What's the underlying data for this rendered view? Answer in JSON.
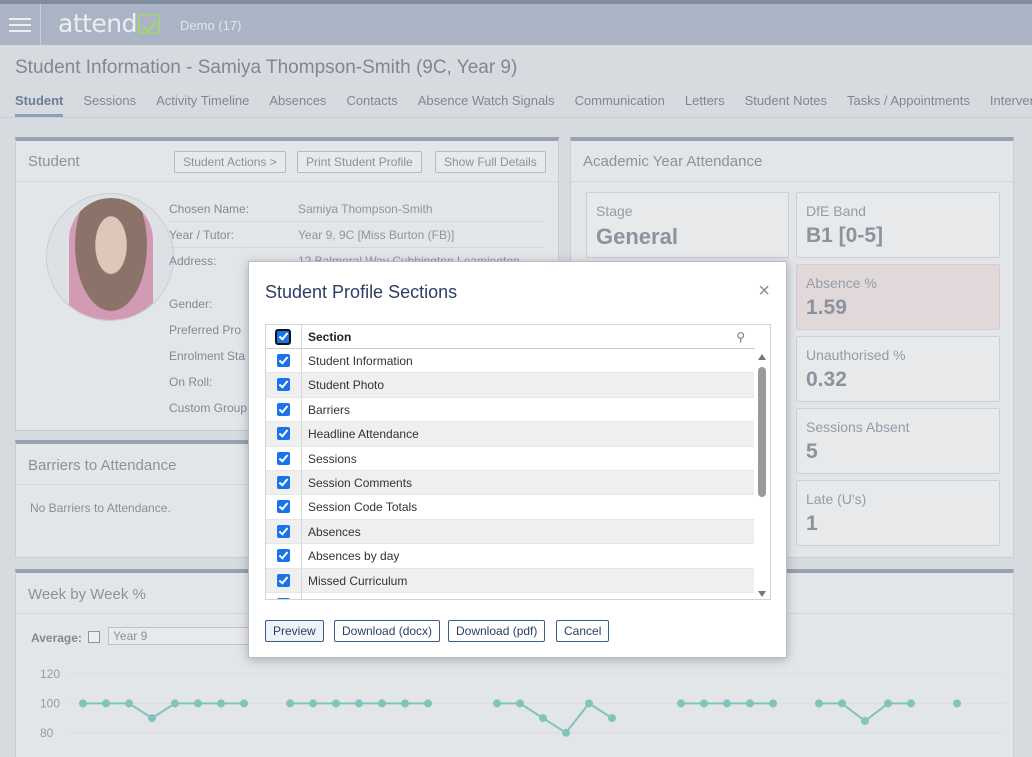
{
  "header": {
    "app_name": "attend",
    "org": "Demo (17)"
  },
  "page": {
    "title": "Student Information - Samiya Thompson-Smith (9C, Year 9)"
  },
  "tabs": [
    "Student",
    "Sessions",
    "Activity Timeline",
    "Absences",
    "Contacts",
    "Absence Watch Signals",
    "Communication",
    "Letters",
    "Student Notes",
    "Tasks / Appointments",
    "Interven"
  ],
  "student_panel": {
    "title": "Student",
    "actions": [
      "Student Actions >",
      "Print Student Profile",
      "Show Full Details"
    ],
    "fields": [
      {
        "label": "Chosen Name:",
        "value": "Samiya Thompson-Smith"
      },
      {
        "label": "Year / Tutor:",
        "value": "Year 9, 9C [Miss Burton (FB)]"
      },
      {
        "label": "Address:",
        "value": "12 Balmoral Way Cubbington Leamington"
      },
      {
        "label": "Gender:",
        "value": ""
      },
      {
        "label": "Preferred Pro",
        "value": ""
      },
      {
        "label": "Enrolment Sta",
        "value": ""
      },
      {
        "label": "On Roll:",
        "value": ""
      },
      {
        "label": "Custom Group",
        "value": ""
      }
    ]
  },
  "barriers_panel": {
    "title": "Barriers to Attendance",
    "text": "No Barriers to Attendance."
  },
  "attendance_panel": {
    "title": "Academic Year Attendance",
    "cards": [
      {
        "label": "Stage",
        "value": "General"
      },
      {
        "label": "DfE Band",
        "value": "B1 [0-5]"
      },
      {
        "label": "Absence %",
        "value": "1.59"
      },
      {
        "label": "Unauthorised %",
        "value": "0.32"
      },
      {
        "label": "Sessions Absent",
        "value": "5"
      },
      {
        "label": "Late (U's)",
        "value": "1"
      }
    ],
    "highlight_color": "#efdede"
  },
  "week_panel": {
    "title": "Week by Week %",
    "average_label": "Average:",
    "year_value": "Year 9",
    "y_ticks": [
      "120",
      "100",
      "80"
    ],
    "series_color": "#5bbfb0",
    "points": [
      100,
      100,
      100,
      90,
      100,
      100,
      100,
      100,
      null,
      100,
      100,
      100,
      100,
      100,
      100,
      100,
      null,
      null,
      100,
      100,
      90,
      80,
      100,
      90,
      null,
      null,
      100,
      100,
      100,
      100,
      100,
      null,
      100,
      100,
      88,
      100,
      100,
      null,
      100
    ]
  },
  "modal": {
    "title": "Student Profile Sections",
    "close_icon": "×",
    "column_header": "Section",
    "sections": [
      "Student Information",
      "Student Photo",
      "Barriers",
      "Headline Attendance",
      "Sessions",
      "Session Comments",
      "Session Code Totals",
      "Absences",
      "Absences by day",
      "Missed Curriculum"
    ],
    "buttons": {
      "preview": "Preview",
      "docx": "Download (docx)",
      "pdf": "Download (pdf)",
      "cancel": "Cancel"
    }
  }
}
